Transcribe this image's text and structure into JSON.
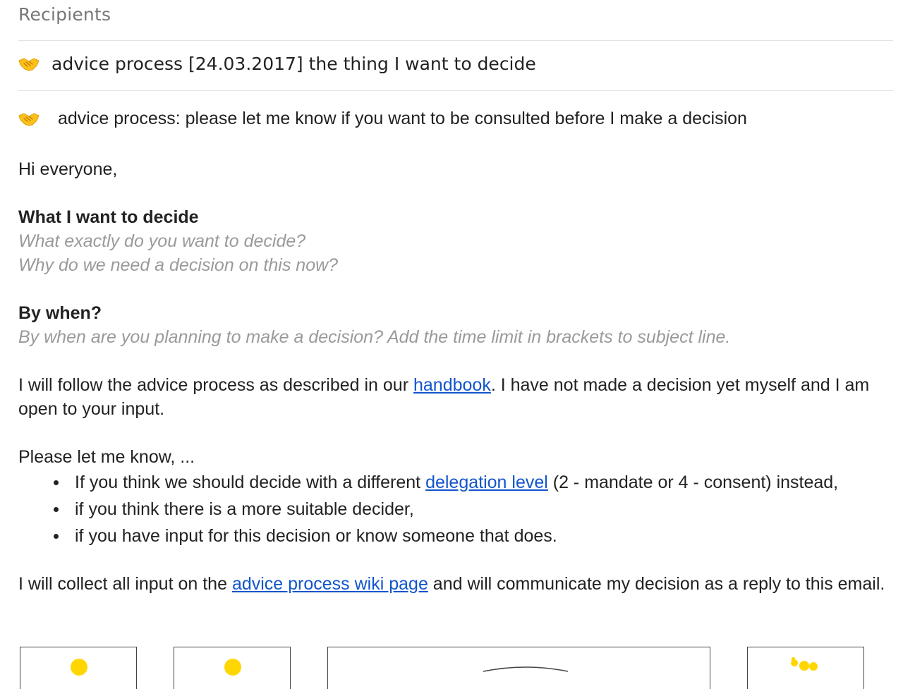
{
  "header": {
    "recipients_label": "Recipients"
  },
  "subject": {
    "icon": "handshake-icon",
    "text": "advice process [24.03.2017] the thing I want to decide"
  },
  "email": {
    "banner_icon": "handshake-icon",
    "banner_text": "advice process: please let me know if you want to be consulted before I make a decision",
    "greeting": "Hi everyone,",
    "section1": {
      "heading": "What I want to decide",
      "hint1": "What exactly do you want to decide?",
      "hint2": "Why do we need a decision on this now?"
    },
    "section2": {
      "heading": "By when?",
      "hint": "By when are you planning to make a decision? Add the time limit in brackets to subject line."
    },
    "para1": {
      "before": "I will follow the advice process as described in our ",
      "link": "handbook",
      "after": ". I have not made a decision yet myself and I am open to your input."
    },
    "ask_intro": "Please let me know, ...",
    "asks": [
      {
        "before": "If you think we should decide with a different ",
        "link": "delegation level",
        "after": " (2 - mandate or 4 - consent) instead,"
      },
      {
        "text": "if you think there is a more suitable decider,"
      },
      {
        "text": "if you have input for this decision or know someone that does."
      }
    ],
    "closing": {
      "before": "I will collect all input on the ",
      "link": "advice process wiki page",
      "after": " and will communicate my decision as a reply to this email."
    }
  },
  "colors": {
    "link": "#1155cc",
    "hint": "#9a9a9a",
    "emoji_yellow": "#fcc21b",
    "emoji_orange": "#f5a623"
  }
}
